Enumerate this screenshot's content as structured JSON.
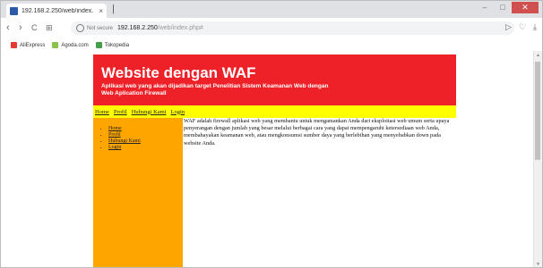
{
  "browser": {
    "tab_title": "192.168.2.250/web/index.",
    "tab_close": "×",
    "new_tab": "|",
    "controls": {
      "minimize": "–",
      "maximize": "□",
      "close": "✕"
    },
    "nav": {
      "back": "‹",
      "forward": "›",
      "reload": "C",
      "apps": "⊞"
    },
    "not_secure": "Not secure",
    "url_host": "192.168.2.250",
    "url_path": "/web/index.php#",
    "icons": {
      "bookmark": "▷",
      "star": "♡",
      "download": "⤓"
    },
    "bookmarks": [
      {
        "label": "AliExpress",
        "color": "#e53935"
      },
      {
        "label": "Agoda.com",
        "color": "#8bc34a"
      },
      {
        "label": "Tokopedia",
        "color": "#43a047"
      }
    ]
  },
  "site": {
    "title": "Website dengan WAF",
    "subtitle_line1": "Aplikasi web yang akan dijadikan target Penelitian Sistem Keamanan Web dengan",
    "subtitle_line2": "Web Aplication Firewall",
    "topnav": [
      "Home",
      "Profil",
      "Hubungi Kami",
      "Login"
    ],
    "sidebar": [
      "Home",
      "Profil",
      "Hubungi Kami",
      "Login"
    ],
    "body_text": "WAF adalah firewall aplikasi web yang membantu untuk mengamankan Anda dari eksploitasi web umum serta upaya penyerangan dengan jumlah yang besar melalui berbagai cara yang dapat mempengaruhi ketersediaan web Anda, membahayakan keamanan web, atau mengkonsumsi sumber daya yang berlebihan yang menyebabkan down pada website Anda.",
    "colors": {
      "header": "#ee2128",
      "nav": "#ffff00",
      "sidebar": "#ffa500"
    }
  }
}
